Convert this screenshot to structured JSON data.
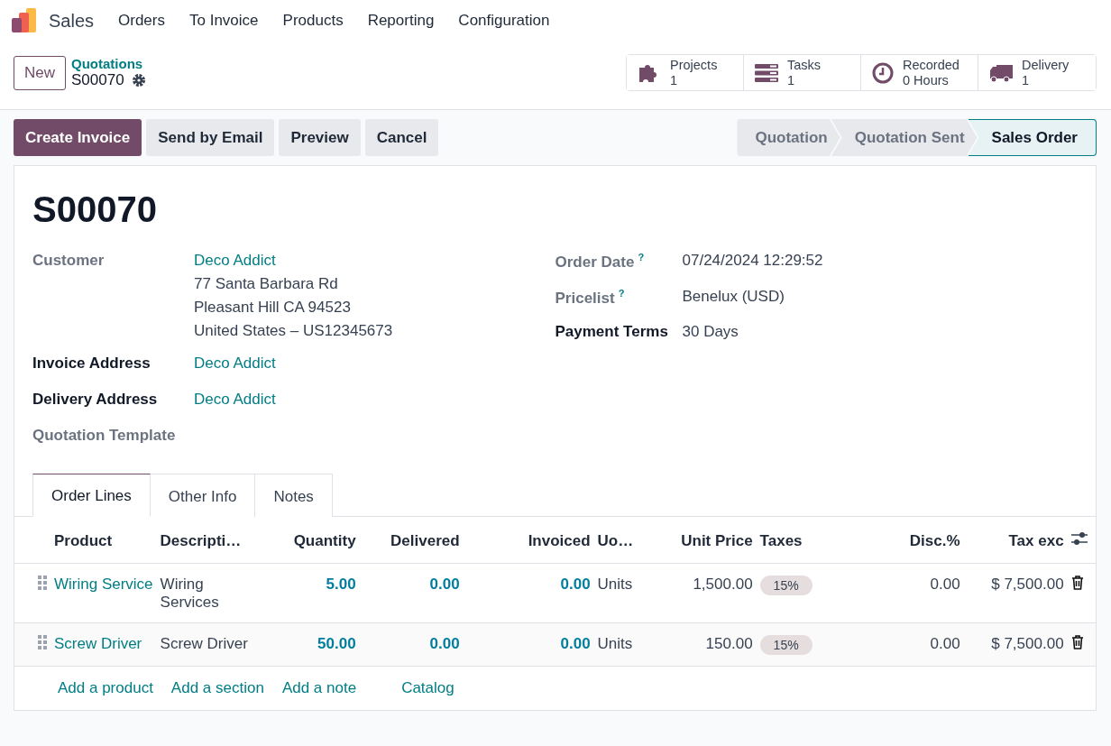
{
  "navbar": {
    "app": "Sales",
    "menu": [
      "Orders",
      "To Invoice",
      "Products",
      "Reporting",
      "Configuration"
    ]
  },
  "control_panel": {
    "new_button": "New",
    "breadcrumb": "Quotations",
    "record": "S00070",
    "smart_buttons": [
      {
        "kind": "projects",
        "label": "Projects",
        "value": "1"
      },
      {
        "kind": "tasks",
        "label": "Tasks",
        "value": "1"
      },
      {
        "kind": "timesheet",
        "label": "Recorded",
        "value": "0 Hours"
      },
      {
        "kind": "delivery",
        "label": "Delivery",
        "value": "1"
      }
    ]
  },
  "actions": [
    {
      "label": "Create Invoice",
      "kind": "primary"
    },
    {
      "label": "Send by Email",
      "kind": "secondary"
    },
    {
      "label": "Preview",
      "kind": "secondary"
    },
    {
      "label": "Cancel",
      "kind": "secondary"
    }
  ],
  "stages": [
    {
      "label": "Quotation",
      "selected": false
    },
    {
      "label": "Quotation Sent",
      "selected": false
    },
    {
      "label": "Sales Order",
      "selected": true
    }
  ],
  "form": {
    "title": "S00070",
    "left_fields": [
      {
        "label": "Customer",
        "required": false,
        "lines": [
          "Deco Addict",
          "77 Santa Barbara Rd",
          "Pleasant Hill CA 94523",
          "United States – US12345673"
        ]
      },
      {
        "label": "Invoice Address",
        "required": true,
        "lines": [
          "Deco Addict"
        ]
      },
      {
        "label": "Delivery Address",
        "required": true,
        "lines": [
          "Deco Addict"
        ]
      },
      {
        "label": "Quotation Template",
        "required": false
      }
    ],
    "right_fields": [
      {
        "label": "Order Date",
        "help": "?",
        "required": false,
        "value": "07/24/2024 12:29:52"
      },
      {
        "label": "Pricelist",
        "help": "?",
        "required": false,
        "value": "Benelux (USD)"
      },
      {
        "label": "Payment Terms",
        "required": true,
        "value": "30 Days"
      }
    ]
  },
  "tabs": [
    {
      "label": "Order Lines",
      "selected": true
    },
    {
      "label": "Other Info",
      "selected": false
    },
    {
      "label": "Notes",
      "selected": false
    }
  ],
  "table": {
    "columns": [
      "Product",
      "Descripti…",
      "Quantity",
      "Delivered",
      "Invoiced",
      "Uo…",
      "Unit Price",
      "Taxes",
      "Disc.%",
      "Tax exc"
    ],
    "rows": [
      {
        "product": "Wiring Service",
        "description": "Wiring Services",
        "quantity": "5.00",
        "delivered": "0.00",
        "invoiced": "0.00",
        "uom": "Units",
        "unit_price": "1,500.00",
        "taxes": [
          "15%"
        ],
        "discount": "0.00",
        "subtotal": "$ 7,500.00"
      },
      {
        "product": "Screw Driver",
        "description": "Screw Driver",
        "quantity": "50.00",
        "delivered": "0.00",
        "invoiced": "0.00",
        "uom": "Units",
        "unit_price": "150.00",
        "taxes": [
          "15%"
        ],
        "discount": "0.00",
        "subtotal": "$ 7,500.00"
      }
    ],
    "add_links": [
      "Add a product",
      "Add a section",
      "Add a note",
      "Catalog"
    ]
  }
}
